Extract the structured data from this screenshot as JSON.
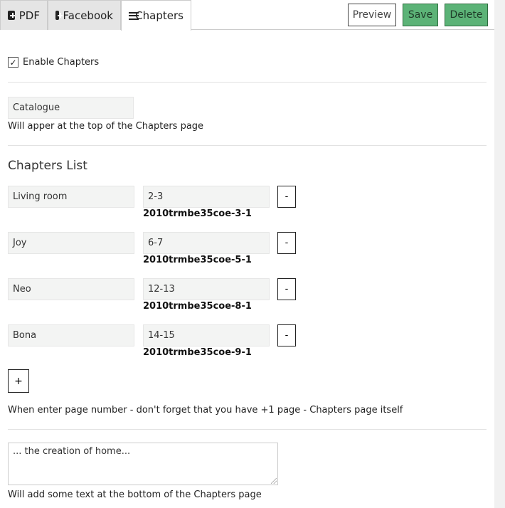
{
  "tabs": [
    {
      "label": "PDF",
      "icon": "plus-square-icon"
    },
    {
      "label": "Facebook",
      "icon": "plus-square-icon"
    },
    {
      "label": "Chapters",
      "icon": "list-icon",
      "active": true
    }
  ],
  "toolbar": {
    "preview_label": "Preview",
    "save_label": "Save",
    "delete_label": "Delete"
  },
  "enable_chapters": {
    "label": "Enable Chapters",
    "checked": true,
    "mark": "✓"
  },
  "catalogue": {
    "value": "Catalogue",
    "help": "Will apper at the top of the Chapters page"
  },
  "chapters": {
    "title": "Chapters List",
    "items": [
      {
        "name": "Living room",
        "pages": "2-3",
        "code": "2010trmbe35coe-3-1",
        "remove_label": "-"
      },
      {
        "name": "Joy",
        "pages": "6-7",
        "code": "2010trmbe35coe-5-1",
        "remove_label": "-"
      },
      {
        "name": "Neo",
        "pages": "12-13",
        "code": "2010trmbe35coe-8-1",
        "remove_label": "-"
      },
      {
        "name": "Bona",
        "pages": "14-15",
        "code": "2010trmbe35coe-9-1",
        "remove_label": "-"
      }
    ],
    "add_label": "+",
    "note": "When enter page number - don't forget that you have +1 page - Chapters page itself"
  },
  "bottom_text": {
    "value": "... the creation of home...",
    "help": "Will add some text at the bottom of the Chapters page"
  },
  "colors": {
    "save": "#5cb377",
    "delete": "#5cb377",
    "field_bg": "#f3f4f3"
  }
}
